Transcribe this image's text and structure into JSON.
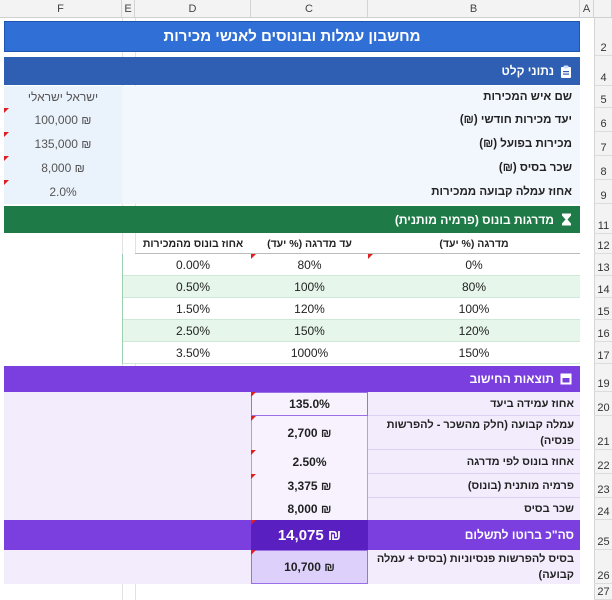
{
  "columns": [
    "F",
    "E",
    "D",
    "C",
    "B",
    "A"
  ],
  "rows": [
    "2",
    "4",
    "5",
    "6",
    "7",
    "8",
    "9",
    "11",
    "12",
    "13",
    "14",
    "15",
    "16",
    "17",
    "19",
    "20",
    "21",
    "22",
    "23",
    "24",
    "25",
    "26",
    "27"
  ],
  "title": "מחשבון עמלות ובונוסים לאנשי מכירות",
  "input_section": {
    "title": "נתוני קלט",
    "icon": "clipboard-icon",
    "labels": [
      "שם איש המכירות",
      "יעד מכירות חודשי (₪)",
      "מכירות בפועל (₪)",
      "שכר בסיס (₪)",
      "אחוז עמלה קבועה ממכירות"
    ],
    "values": [
      "ישראל ישראלי",
      "₪ 100,000",
      "₪ 135,000",
      "₪ 8,000",
      "2.0%"
    ]
  },
  "tiers_section": {
    "title": "מדרגות בונוס (פרמיה מותנית)",
    "icon": "hourglass-icon",
    "headers": [
      "מדרגה (% יעד)",
      "עד מדרגה (% יעד)",
      "אחוז בונוס מהמכירות"
    ],
    "rows": [
      [
        "0%",
        "80%",
        "0.00%"
      ],
      [
        "80%",
        "100%",
        "0.50%"
      ],
      [
        "100%",
        "120%",
        "1.50%"
      ],
      [
        "120%",
        "150%",
        "2.50%"
      ],
      [
        "150%",
        "1000%",
        "3.50%"
      ]
    ]
  },
  "results_section": {
    "title": "תוצאות החישוב",
    "icon": "box-icon",
    "labels": [
      "אחוז עמידה ביעד",
      "עמלה קבועה (חלק מהשכר - להפרשות פנסיה)",
      "אחוז בונוס לפי מדרגה",
      "פרמיה מותנית (בונוס)",
      "שכר בסיס"
    ],
    "values": [
      "135.0%",
      "₪ 2,700",
      "2.50%",
      "₪ 3,375",
      "₪ 8,000"
    ],
    "total_label": "סה\"כ ברוטו לתשלום",
    "total_value": "₪ 14,075",
    "pension_label": "בסיס להפרשות פנסיוניות (בסיס + עמלה קבועה)",
    "pension_value": "₪ 10,700"
  },
  "colors": {
    "title_blue": "#2f6fd6",
    "section_blue": "#2f5fb3",
    "green": "#1e7a46",
    "purple": "#7b3fe0",
    "purple_dark": "#5a1fc0"
  }
}
